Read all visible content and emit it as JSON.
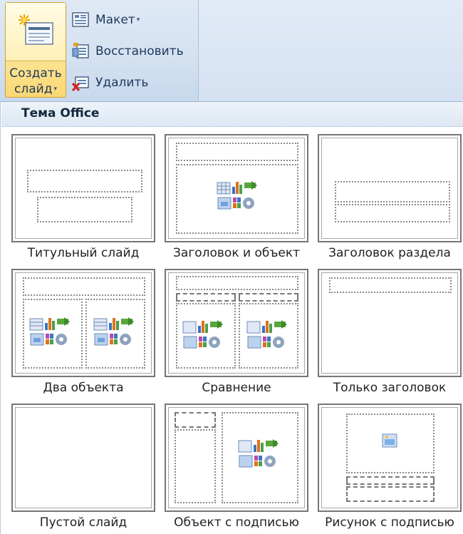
{
  "ribbon": {
    "new_slide_line1": "Создать",
    "new_slide_line2": "слайд",
    "layout_label": "Макет",
    "reset_label": "Восстановить",
    "delete_label": "Удалить",
    "dropdown_glyph": "▾"
  },
  "gallery": {
    "title": "Тема Office",
    "layouts": [
      {
        "name": "Титульный слайд"
      },
      {
        "name": "Заголовок и объект"
      },
      {
        "name": "Заголовок раздела"
      },
      {
        "name": "Два объекта"
      },
      {
        "name": "Сравнение"
      },
      {
        "name": "Только заголовок"
      },
      {
        "name": "Пустой слайд"
      },
      {
        "name": "Объект с подписью"
      },
      {
        "name": "Рисунок с подписью"
      }
    ]
  },
  "colors": {
    "ribbon_bg": "#d3e1f1",
    "button_highlight": "#fde9a0",
    "label_text": "#1e395b",
    "thumb_border": "#767676"
  }
}
